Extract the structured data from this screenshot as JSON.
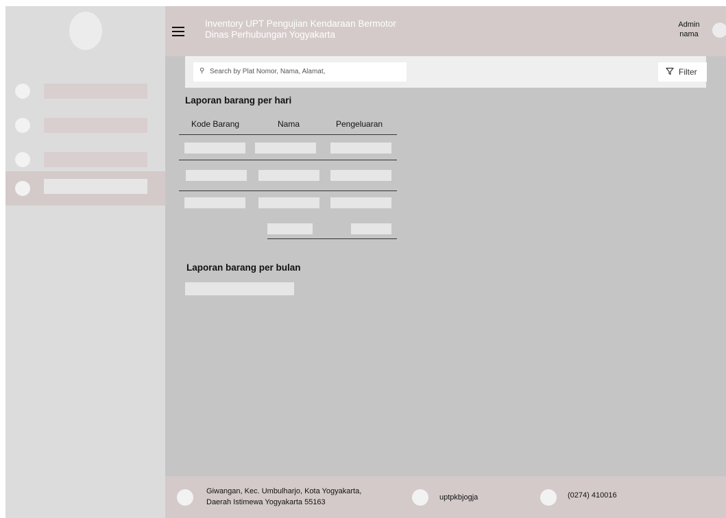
{
  "header": {
    "title_line1": "Inventory UPT Pengujian Kendaraan Bermotor",
    "title_line2": "Dinas Perhubungan Yogyakarta",
    "admin_line1": "Admin",
    "admin_line2": "nama"
  },
  "sidebar": {
    "items": [
      {
        "name": "menu-1",
        "active": false
      },
      {
        "name": "menu-2",
        "active": false
      },
      {
        "name": "menu-3",
        "active": false
      },
      {
        "name": "menu-4",
        "active": true
      }
    ]
  },
  "search": {
    "placeholder": "Search by Plat Nomor, Nama, Alamat,",
    "filter_label": "Filter"
  },
  "daily_report": {
    "title": "Laporan barang per hari",
    "columns": [
      "Kode Barang",
      "Nama",
      "Pengeluaran"
    ],
    "rows": [
      [
        "",
        "",
        ""
      ],
      [
        "",
        "",
        ""
      ],
      [
        "",
        "",
        ""
      ]
    ],
    "totals": [
      "",
      ""
    ]
  },
  "monthly_report": {
    "title": "Laporan barang per bulan",
    "value": ""
  },
  "footer": {
    "address_line1": "Giwangan, Kec. Umbulharjo, Kota Yogyakarta,",
    "address_line2": "Daerah Istimewa Yogyakarta 55163",
    "social": "uptpkbjogja",
    "phone": "(0274) 410016"
  },
  "colors": {
    "header_bg": "#d4caca",
    "content_bg": "#c5c5c5",
    "sidebar_bg": "#dcdcdc"
  }
}
